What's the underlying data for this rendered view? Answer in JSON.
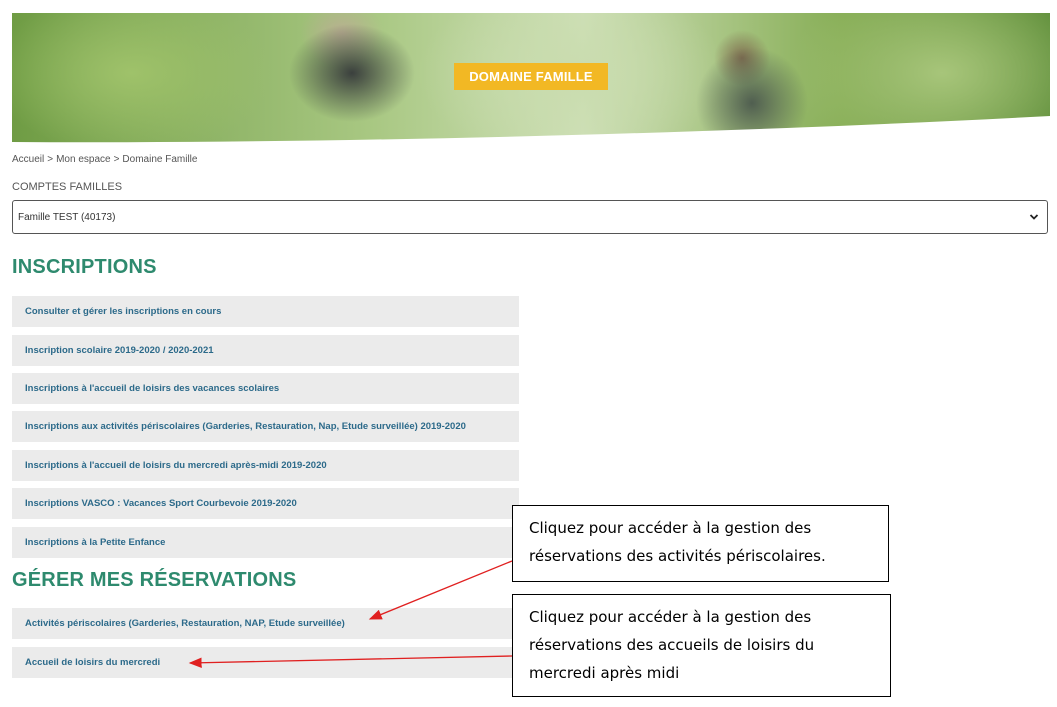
{
  "banner": {
    "title": "DOMAINE FAMILLE"
  },
  "breadcrumb": {
    "items": [
      "Accueil",
      ">",
      "Mon espace",
      ">",
      "Domaine Famille"
    ]
  },
  "family_accounts": {
    "label": "COMPTES FAMILLES",
    "selected": "Famille TEST (40173)"
  },
  "inscriptions": {
    "heading": "INSCRIPTIONS",
    "items": [
      "Consulter et gérer les inscriptions en cours",
      "Inscription scolaire 2019-2020 / 2020-2021",
      "Inscriptions à l'accueil de loisirs des vacances scolaires",
      "Inscriptions aux activités périscolaires (Garderies, Restauration, Nap, Etude surveillée) 2019-2020",
      "Inscriptions à l'accueil de loisirs du mercredi après-midi 2019-2020",
      "Inscriptions VASCO : Vacances Sport Courbevoie 2019-2020",
      "Inscriptions à la Petite Enfance"
    ]
  },
  "reservations": {
    "heading": "GÉRER MES RÉSERVATIONS",
    "items": [
      "Activités périscolaires (Garderies, Restauration, NAP, Etude surveillée)",
      "Accueil de loisirs du mercredi"
    ]
  },
  "callouts": [
    {
      "lines": [
        "Cliquez pour accéder à la gestion des",
        "réservations des activités périscolaires."
      ]
    },
    {
      "lines": [
        "Cliquez pour accéder à la gestion des",
        "réservations des accueils de loisirs du",
        "mercredi après midi"
      ]
    }
  ],
  "colors": {
    "heading": "#2e8a6e",
    "link": "#2c6a8a",
    "banner_badge": "#f2b824",
    "arrow": "#e02020"
  },
  "icons": {
    "select": "chevron-down-icon"
  }
}
